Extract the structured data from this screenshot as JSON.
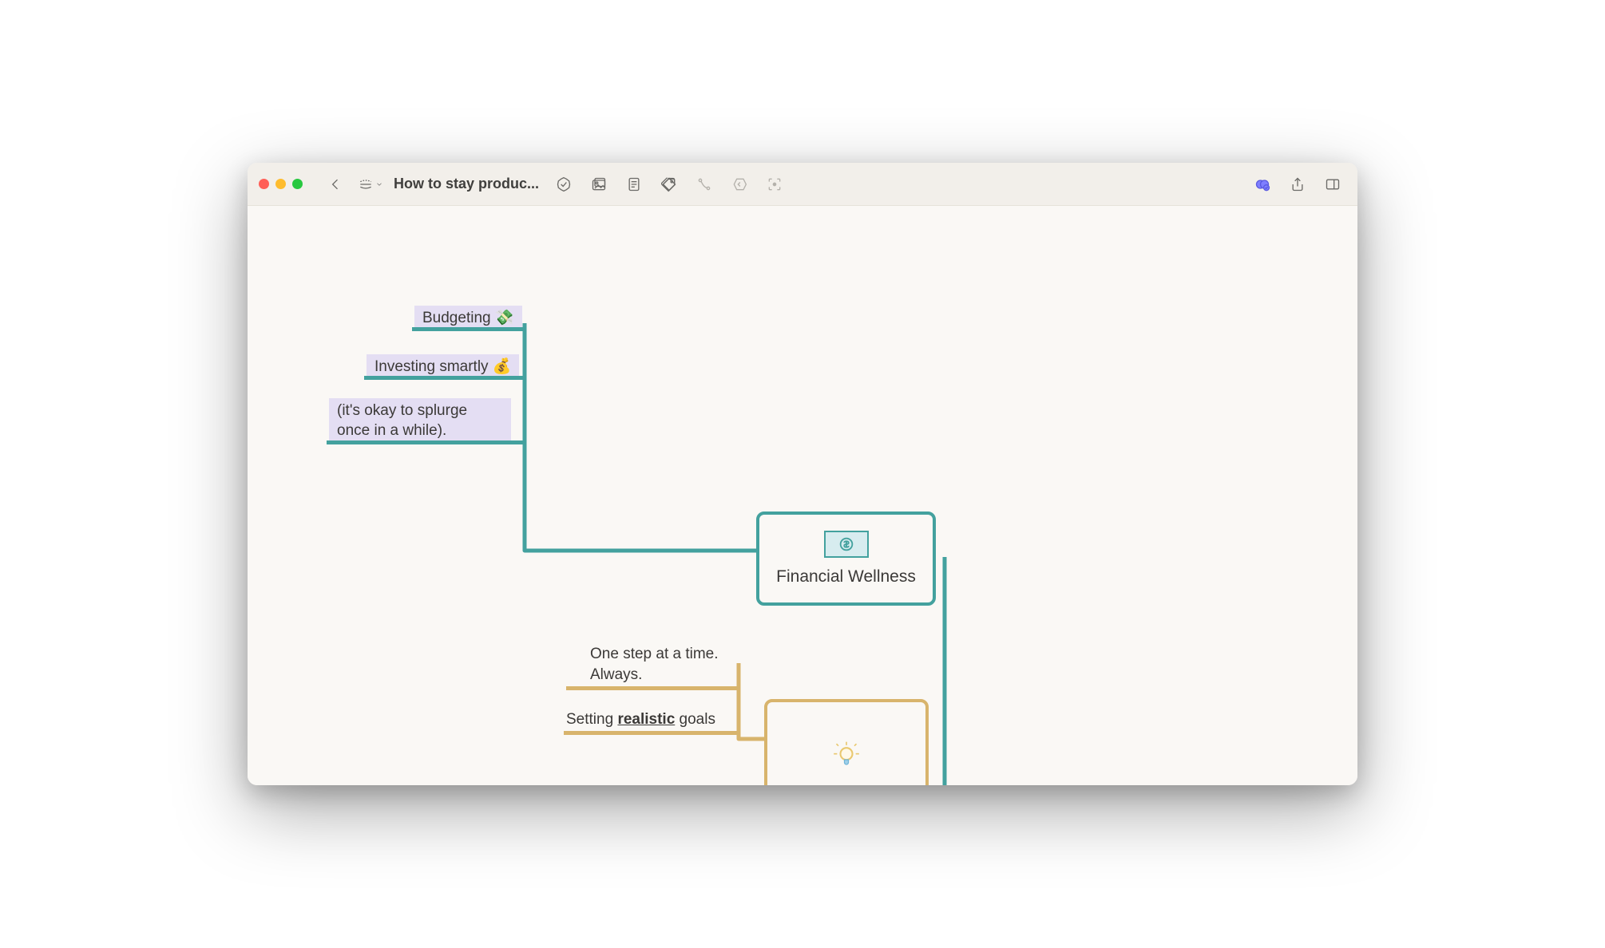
{
  "window": {
    "title": "How to stay produc..."
  },
  "toolbar": {
    "icons": {
      "back": "back",
      "view_mode": "mindmap-view",
      "checklist": "checklist",
      "image": "image",
      "note": "note",
      "tag": "tag",
      "connector": "connector",
      "shape": "shape-back",
      "focus": "focus",
      "collaborate": "collaborate",
      "share": "share",
      "sidebar": "sidebar-toggle"
    }
  },
  "mindmap": {
    "central": {
      "label": "Financial Wellness"
    },
    "teal_branch": {
      "nodes": [
        {
          "text": "Budgeting 💸"
        },
        {
          "text": "Investing smartly 💰"
        },
        {
          "text": "(it's okay to splurge once in a while)."
        }
      ]
    },
    "tan_branch": {
      "nodes": [
        {
          "line1": "One step at a time.",
          "line2": "Always."
        },
        {
          "prefix": "Setting ",
          "emph": "realistic",
          "suffix": " goals"
        }
      ]
    }
  },
  "colors": {
    "teal": "#43a19e",
    "tan": "#d8b46c",
    "lavender": "#e4def3",
    "canvas": "#faf8f5"
  }
}
